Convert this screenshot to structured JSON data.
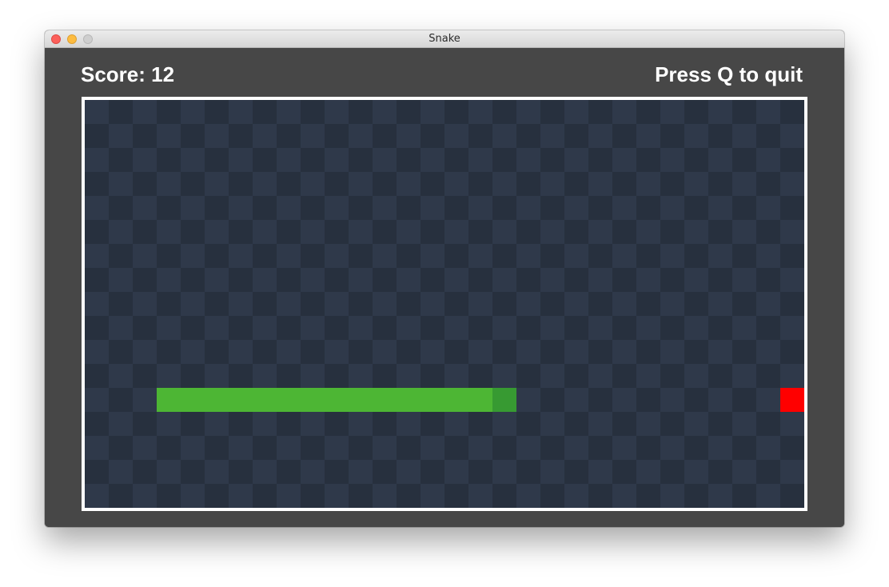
{
  "window": {
    "title": "Snake",
    "controls": [
      "close",
      "minimize",
      "zoom"
    ]
  },
  "hud": {
    "score_text": "Score: 12",
    "quit_hint": "Press Q to quit"
  },
  "board": {
    "columns": 30,
    "rows": 17,
    "colors": {
      "light_tile": "#2f394a",
      "dark_tile": "#27303e",
      "snake_body": "#4db634",
      "snake_head": "#379a32",
      "food": "#ff0000",
      "frame": "#ffffff",
      "background": "#474747"
    },
    "snake": [
      {
        "col": 3,
        "row": 12
      },
      {
        "col": 4,
        "row": 12
      },
      {
        "col": 5,
        "row": 12
      },
      {
        "col": 6,
        "row": 12
      },
      {
        "col": 7,
        "row": 12
      },
      {
        "col": 8,
        "row": 12
      },
      {
        "col": 9,
        "row": 12
      },
      {
        "col": 10,
        "row": 12
      },
      {
        "col": 11,
        "row": 12
      },
      {
        "col": 12,
        "row": 12
      },
      {
        "col": 13,
        "row": 12
      },
      {
        "col": 14,
        "row": 12
      },
      {
        "col": 15,
        "row": 12
      },
      {
        "col": 16,
        "row": 12
      },
      {
        "col": 17,
        "row": 12
      }
    ],
    "head_index": 14,
    "food": {
      "col": 29,
      "row": 12
    }
  }
}
